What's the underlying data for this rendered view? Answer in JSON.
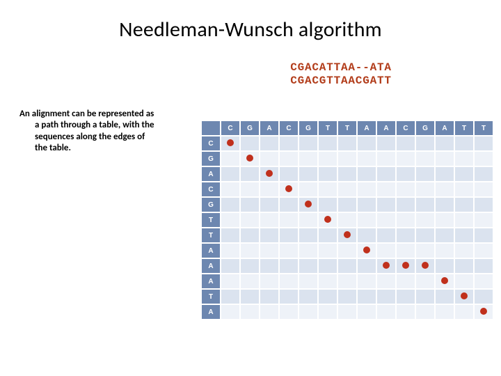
{
  "title": "Needleman-Wunsch algorithm",
  "alignment": {
    "seq1": "CGACATTAA--ATA",
    "seq2": "CGACGTTAACGATT"
  },
  "description": {
    "line1": "An alignment can be represented as",
    "line2": "a path through a table, with the",
    "line3": "sequences along the edges of",
    "line4": "the table."
  },
  "matrix": {
    "cols": [
      "C",
      "G",
      "A",
      "C",
      "G",
      "T",
      "T",
      "A",
      "A",
      "C",
      "G",
      "A",
      "T",
      "T"
    ],
    "rows": [
      "C",
      "G",
      "A",
      "C",
      "G",
      "T",
      "T",
      "A",
      "A",
      "A",
      "T",
      "A"
    ],
    "path": [
      [
        0,
        0
      ],
      [
        1,
        1
      ],
      [
        2,
        2
      ],
      [
        3,
        3
      ],
      [
        4,
        4
      ],
      [
        5,
        5
      ],
      [
        6,
        6
      ],
      [
        7,
        7
      ],
      [
        8,
        8
      ],
      [
        8,
        9
      ],
      [
        8,
        10
      ],
      [
        9,
        11
      ],
      [
        10,
        12
      ],
      [
        11,
        13
      ]
    ]
  },
  "colors": {
    "header_bg": "#6d87b0",
    "row_even": "#dbe3ef",
    "row_odd": "#eef2f8",
    "dot": "#c0301c",
    "seq_text": "#b23c1a"
  }
}
